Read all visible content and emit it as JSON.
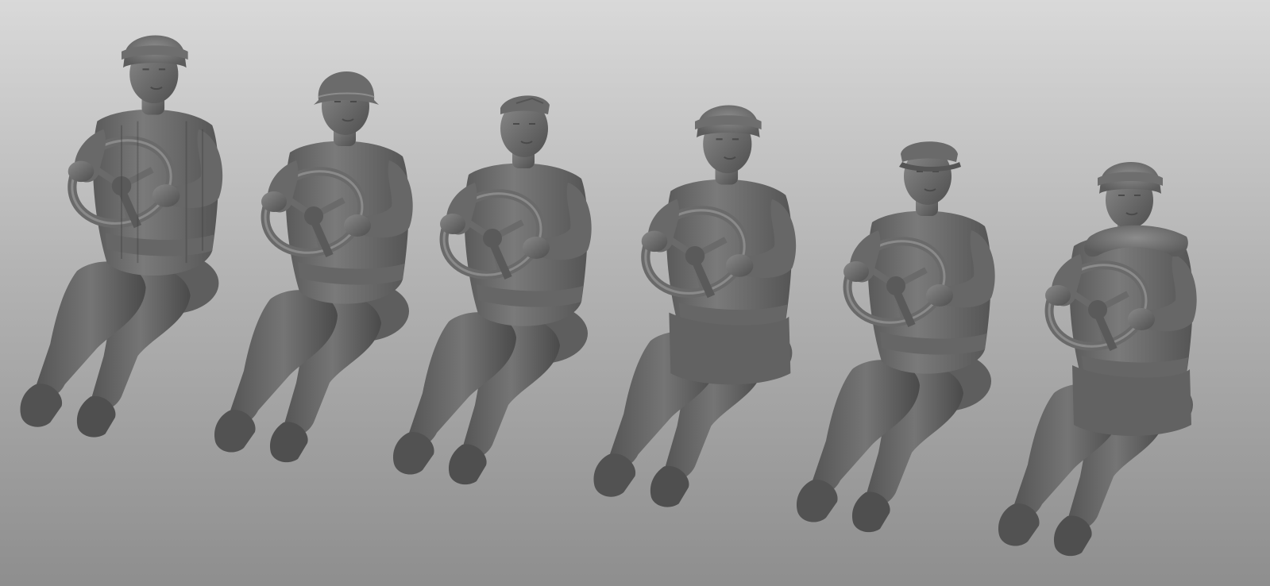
{
  "viewport": {
    "background_top": "#d9d9d9",
    "background_bottom": "#8e8e8e",
    "mesh_color": "#6e6e6e"
  },
  "figures": [
    {
      "id": "driver-1",
      "headgear": "ushanka",
      "torso": "padded-jacket",
      "legs": "boots"
    },
    {
      "id": "driver-2",
      "headgear": "helmet",
      "torso": "gymnastyorka",
      "legs": "boots"
    },
    {
      "id": "driver-3",
      "headgear": "pilotka",
      "torso": "gymnastyorka",
      "legs": "boots"
    },
    {
      "id": "driver-4",
      "headgear": "ushanka",
      "torso": "greatcoat",
      "legs": "boots"
    },
    {
      "id": "driver-5",
      "headgear": "peaked-cap",
      "torso": "gymnastyorka",
      "legs": "boots"
    },
    {
      "id": "driver-6",
      "headgear": "ushanka",
      "torso": "fur-collar-coat",
      "legs": "boots"
    }
  ]
}
